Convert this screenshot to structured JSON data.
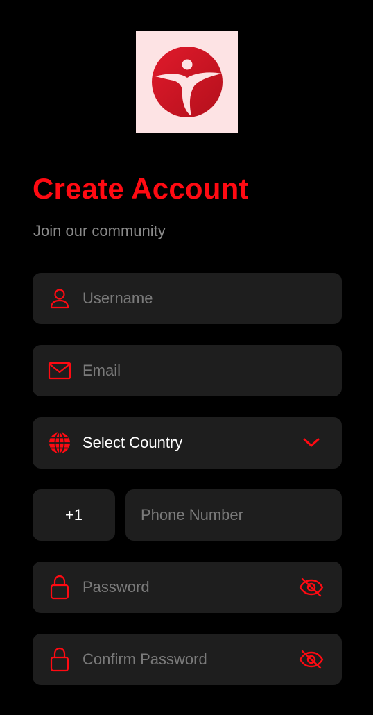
{
  "colors": {
    "accent": "#ff0a12",
    "background": "#000000",
    "field_background": "#1e1e1e",
    "placeholder": "#7a7a7a",
    "subtitle": "#8a8a8a",
    "logo_background": "#fde3e4"
  },
  "logo": {
    "icon": "running-person-logo"
  },
  "header": {
    "title": "Create Account",
    "subtitle": "Join our community"
  },
  "form": {
    "username": {
      "placeholder": "Username",
      "value": "",
      "icon": "user-icon"
    },
    "email": {
      "placeholder": "Email",
      "value": "",
      "icon": "mail-icon"
    },
    "country": {
      "label": "Select Country",
      "icon": "globe-icon",
      "trailing_icon": "chevron-down-icon"
    },
    "phone": {
      "country_code": "+1",
      "placeholder": "Phone Number",
      "value": ""
    },
    "password": {
      "placeholder": "Password",
      "value": "",
      "icon": "lock-icon",
      "trailing_icon": "eye-off-icon"
    },
    "confirm_password": {
      "placeholder": "Confirm Password",
      "value": "",
      "icon": "lock-icon",
      "trailing_icon": "eye-off-icon"
    }
  }
}
